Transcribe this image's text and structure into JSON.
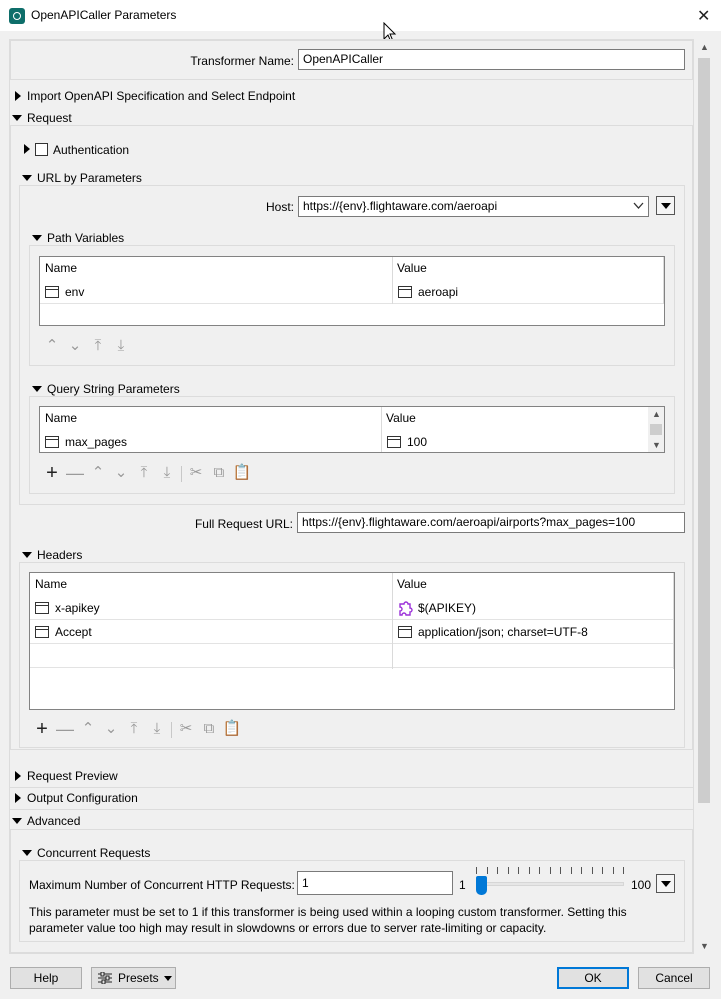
{
  "window": {
    "title": "OpenAPICaller Parameters"
  },
  "transformer": {
    "label": "Transformer Name:",
    "value": "OpenAPICaller"
  },
  "sections": {
    "import": "Import OpenAPI Specification and Select Endpoint",
    "request": "Request",
    "authentication": "Authentication",
    "url_by_params": "URL by Parameters",
    "path_variables": "Path Variables",
    "query_string": "Query String Parameters",
    "headers": "Headers",
    "request_preview": "Request Preview",
    "output_config": "Output Configuration",
    "advanced": "Advanced",
    "concurrent": "Concurrent Requests"
  },
  "host": {
    "label": "Host:",
    "value": "https://{env}.flightaware.com/aeroapi"
  },
  "path_variables": {
    "columns": [
      "Name",
      "Value"
    ],
    "rows": [
      {
        "name": "env",
        "value": "aeroapi"
      }
    ]
  },
  "query_params": {
    "columns": [
      "Name",
      "Value"
    ],
    "rows": [
      {
        "name": "max_pages",
        "value": "100"
      }
    ]
  },
  "full_url": {
    "label": "Full Request URL:",
    "value": "https://{env}.flightaware.com/aeroapi/airports?max_pages=100"
  },
  "headers": {
    "columns": [
      "Name",
      "Value"
    ],
    "rows": [
      {
        "name": "x-apikey",
        "value": "$(APIKEY)",
        "icon": "puzzle-icon"
      },
      {
        "name": "Accept",
        "value": "application/json; charset=UTF-8",
        "icon": "text-icon"
      }
    ]
  },
  "concurrency": {
    "label": "Maximum Number of Concurrent HTTP Requests:",
    "value": "1",
    "slider_min": "1",
    "slider_max": "100",
    "slider_level": 1,
    "note": "This parameter must be set to 1 if this transformer is being used within a looping custom transformer. Setting this parameter value too high may result in slowdowns or errors due to server rate-limiting or capacity."
  },
  "footer": {
    "help": "Help",
    "presets": "Presets",
    "ok": "OK",
    "cancel": "Cancel"
  },
  "colors": {
    "accent": "#0078d7",
    "slider": "#0078d7",
    "puzzle": "#9b30d9"
  }
}
